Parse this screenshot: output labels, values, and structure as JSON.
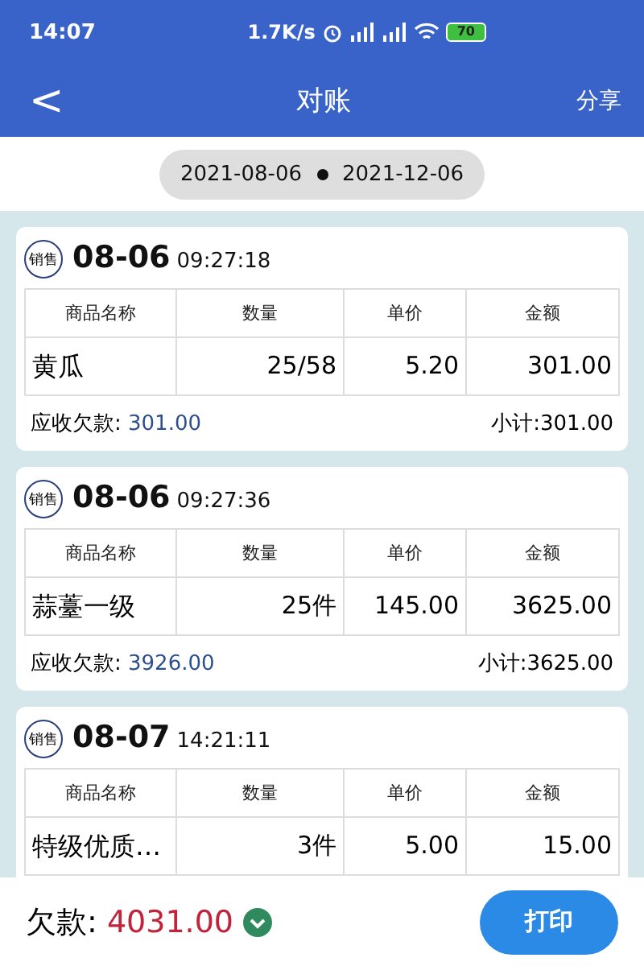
{
  "status_bar": {
    "time": "14:07",
    "speed": "1.7K/s",
    "battery": "70"
  },
  "nav": {
    "back": "<",
    "title": "对账",
    "action": "分享"
  },
  "date_range": {
    "start": "2021-08-06",
    "end": "2021-12-06"
  },
  "orders": [
    {
      "badge": "销售",
      "date": "08-06",
      "time": "09:27:18",
      "columns": [
        "商品名称",
        "数量",
        "单价",
        "金额"
      ],
      "rows": [
        [
          "黄瓜",
          "25/58",
          "5.20",
          "301.00"
        ]
      ],
      "debt_label": "应收欠款:",
      "debt_value": "301.00",
      "subtotal": "小计:301.00"
    },
    {
      "badge": "销售",
      "date": "08-06",
      "time": "09:27:36",
      "columns": [
        "商品名称",
        "数量",
        "单价",
        "金额"
      ],
      "rows": [
        [
          "蒜薹一级",
          "25件",
          "145.00",
          "3625.00"
        ]
      ],
      "debt_label": "应收欠款:",
      "debt_value": "3926.00",
      "subtotal": "小计:3625.00"
    },
    {
      "badge": "销售",
      "date": "08-07",
      "time": "14:21:11",
      "columns": [
        "商品名称",
        "数量",
        "单价",
        "金额"
      ],
      "rows": [
        [
          "特级优质…",
          "3件",
          "5.00",
          "15.00"
        ]
      ]
    }
  ],
  "footer": {
    "label": "欠款:",
    "value": "4031.00",
    "button": "打印"
  }
}
